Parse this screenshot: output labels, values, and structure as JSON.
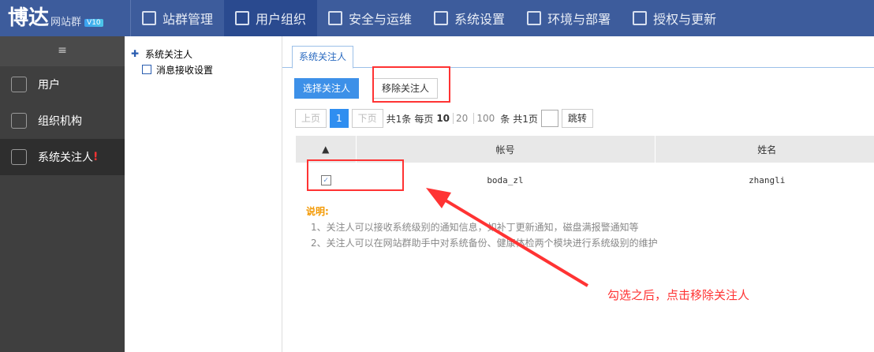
{
  "header": {
    "logo": "博达",
    "product": "网站群",
    "version": "V10",
    "nav": [
      {
        "label": "站群管理",
        "icon": "site-icon"
      },
      {
        "label": "用户组织",
        "icon": "user-card-icon",
        "active": true
      },
      {
        "label": "安全与运维",
        "icon": "shield-icon"
      },
      {
        "label": "系统设置",
        "icon": "settings-icon"
      },
      {
        "label": "环境与部署",
        "icon": "deploy-icon"
      },
      {
        "label": "授权与更新",
        "icon": "license-icon"
      }
    ]
  },
  "sidebar": {
    "collapse_icon": "≡",
    "items": [
      {
        "label": "用户"
      },
      {
        "label": "组织机构"
      },
      {
        "label": "系统关注人",
        "badge": "!",
        "active": true
      }
    ]
  },
  "tree": {
    "items": [
      "系统关注人",
      "消息接收设置"
    ]
  },
  "main": {
    "tab": "系统关注人",
    "select_button": "选择关注人",
    "remove_button": "移除关注人",
    "pager": {
      "prev": "上页",
      "current": "1",
      "next": "下页",
      "total": "共1条",
      "per_page_label": "每页",
      "sizes": [
        "10",
        "20",
        "100"
      ],
      "unit": "条",
      "pages": "共1页",
      "jump": "跳转"
    },
    "table": {
      "sort_icon": "▲",
      "columns": [
        "帐号",
        "姓名"
      ],
      "rows": [
        {
          "checked": true,
          "account": "boda_zl",
          "name": "zhangli"
        }
      ]
    },
    "note": {
      "title": "说明:",
      "lines": [
        "1、关注人可以接收系统级别的通知信息，如补丁更新通知，磁盘满报警通知等",
        "2、关注人可以在网站群助手中对系统备份、健康体检两个模块进行系统级别的维护"
      ]
    }
  },
  "annotation": {
    "text": "勾选之后，点击移除关注人",
    "color": "#ff3333"
  }
}
